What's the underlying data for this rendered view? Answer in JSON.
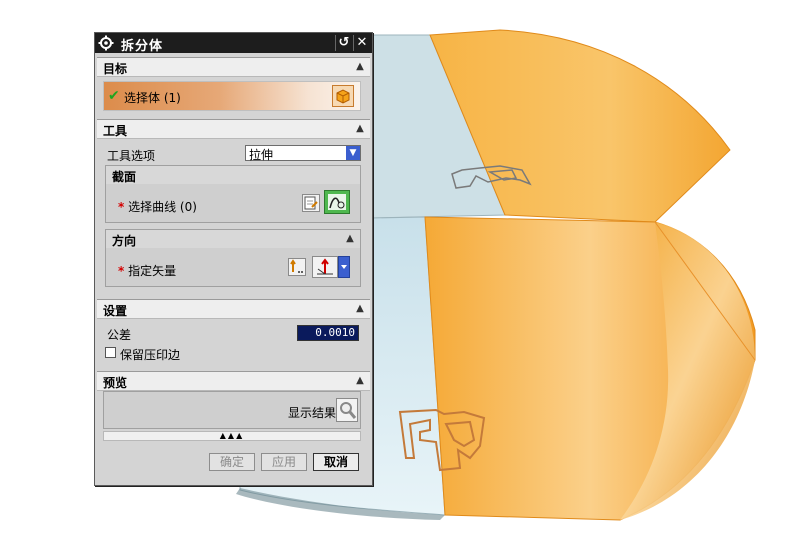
{
  "dialog": {
    "title": "拆分体",
    "groups": {
      "target": {
        "label": "目标",
        "select_label": "选择体 (1)"
      },
      "tool": {
        "label": "工具",
        "option_label": "工具选项",
        "option_value": "拉伸",
        "section": {
          "label": "截面",
          "select_curve_label": "选择曲线 (0)"
        },
        "direction": {
          "label": "方向",
          "vector_label": "指定矢量"
        }
      },
      "settings": {
        "label": "设置",
        "tolerance_label": "公差",
        "tolerance_value": "0.0010",
        "keep_imprint_label": "保留压印边"
      },
      "preview": {
        "label": "预览",
        "show_result_label": "显示结果"
      }
    },
    "buttons": {
      "ok": "确定",
      "apply": "应用",
      "cancel": "取消"
    }
  },
  "colors": {
    "body_orange": "#f6b041",
    "body_face": "#cfe3ea",
    "titlebar": "#1d1d1d",
    "tolerance_field": "#0a1a5c"
  }
}
